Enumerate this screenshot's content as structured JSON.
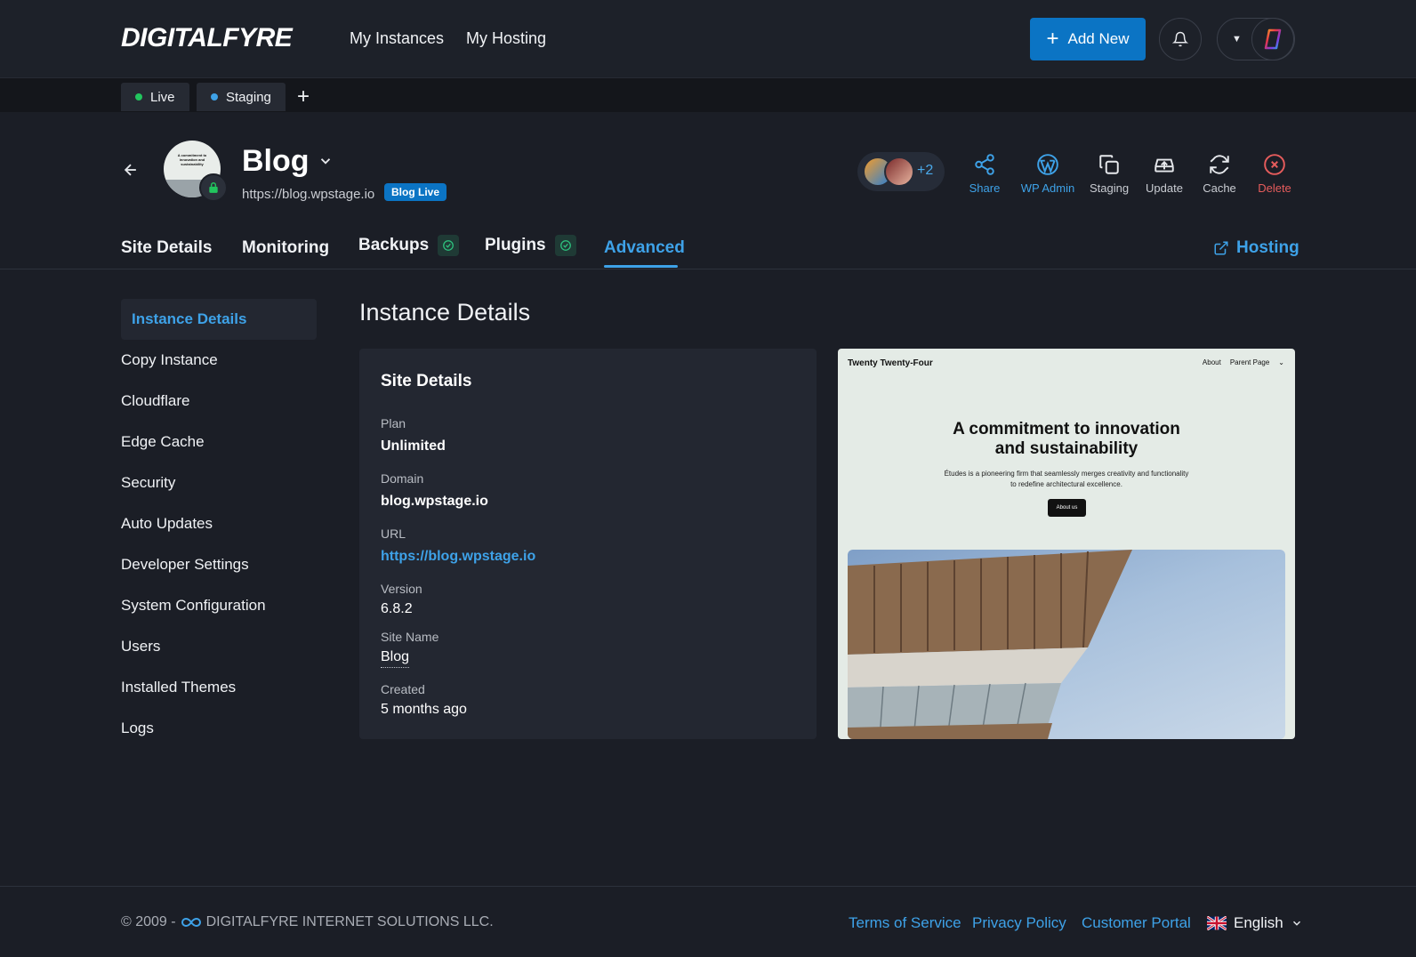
{
  "brand": {
    "logo": "DIGITALFYRE"
  },
  "nav": {
    "my_instances": "My Instances",
    "my_hosting": "My Hosting",
    "add_new": "Add New"
  },
  "env_tabs": [
    {
      "label": "Live",
      "dot_color": "#22c55e"
    },
    {
      "label": "Staging",
      "dot_color": "#3ea2e8"
    }
  ],
  "site": {
    "name": "Blog",
    "url": "https://blog.wpstage.io",
    "status_badge": "Blog Live",
    "thumb_text": "A commitment to innovation and sustainability"
  },
  "collaborators": {
    "extra_count": "+2"
  },
  "actions": [
    {
      "label": "Share",
      "icon": "share-icon"
    },
    {
      "label": "WP Admin",
      "icon": "wordpress-icon"
    },
    {
      "label": "Staging",
      "icon": "copy-icon"
    },
    {
      "label": "Update",
      "icon": "cloud-upload-icon"
    },
    {
      "label": "Cache",
      "icon": "refresh-icon"
    },
    {
      "label": "Delete",
      "icon": "close-circle-icon"
    }
  ],
  "tabs": [
    {
      "label": "Site Details"
    },
    {
      "label": "Monitoring"
    },
    {
      "label": "Backups"
    },
    {
      "label": "Plugins"
    },
    {
      "label": "Advanced"
    }
  ],
  "hosting_link": "Hosting",
  "sidebar": [
    "Instance Details",
    "Copy Instance",
    "Cloudflare",
    "Edge Cache",
    "Security",
    "Auto Updates",
    "Developer Settings",
    "System Configuration",
    "Users",
    "Installed Themes",
    "Logs"
  ],
  "content": {
    "title": "Instance Details",
    "card_title": "Site Details",
    "fields": {
      "plan_label": "Plan",
      "plan": "Unlimited",
      "domain_label": "Domain",
      "domain": "blog.wpstage.io",
      "url_label": "URL",
      "url": "https://blog.wpstage.io",
      "version_label": "Version",
      "version": "6.8.2",
      "sitename_label": "Site Name",
      "sitename": "Blog",
      "created_label": "Created",
      "created": "5 months ago"
    }
  },
  "preview": {
    "brand": "Twenty Twenty-Four",
    "nav_about": "About",
    "nav_parent": "Parent Page",
    "headline_1": "A commitment to innovation",
    "headline_2": "and sustainability",
    "sub_1": "Études is a pioneering firm that seamlessly merges creativity and functionality",
    "sub_2": "to redefine architectural excellence.",
    "button": "About us"
  },
  "footer": {
    "copyright": "© 2009 -",
    "company": "DIGITALFYRE INTERNET SOLUTIONS LLC.",
    "terms": "Terms of Service",
    "privacy": "Privacy Policy",
    "portal": "Customer Portal",
    "language": "English"
  },
  "colors": {
    "accent": "#3ea2e8",
    "primary_button": "#0b74c4",
    "danger": "#e65c5c",
    "background": "#1b1e26"
  }
}
